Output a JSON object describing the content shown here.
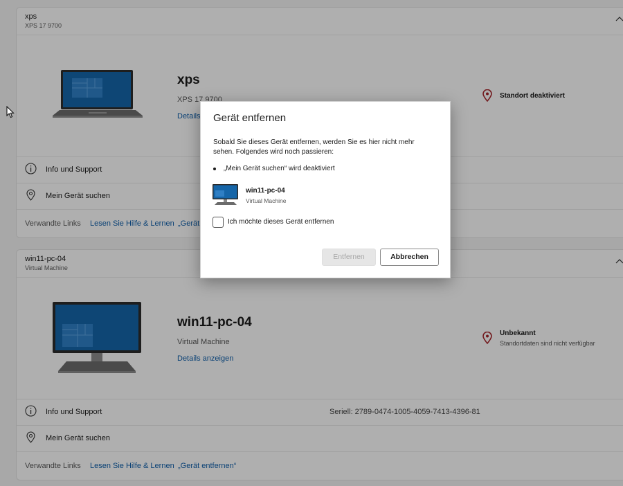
{
  "cards": [
    {
      "head_name": "xps",
      "head_sub": "XPS 17 9700",
      "big_name": "xps",
      "model": "XPS 17 9700",
      "details_label": "Details",
      "location_title": "Standort deaktiviert",
      "info_label": "Info und Support",
      "find_label": "Mein Gerät suchen",
      "related_label": "Verwandte Links",
      "help_link": "Lesen Sie Hilfe & Lernen",
      "remove_link": "„Gerät"
    },
    {
      "head_name": "win11-pc-04",
      "head_sub": "Virtual Machine",
      "big_name": "win11-pc-04",
      "model": "Virtual Machine",
      "details_label": "Details anzeigen",
      "location_title": "Unbekannt",
      "location_sub": "Standortdaten sind nicht verfügbar",
      "info_label": "Info und Support",
      "serial": "Seriell: 2789-0474-1005-4059-7413-4396-81",
      "find_label": "Mein Gerät suchen",
      "related_label": "Verwandte Links",
      "help_link": "Lesen Sie Hilfe & Lernen",
      "remove_link": "„Gerät entfernen“"
    }
  ],
  "dialog": {
    "title": "Gerät entfernen",
    "body": "Sobald Sie dieses Gerät entfernen, werden Sie es hier nicht mehr sehen. Folgendes wird noch passieren:",
    "bullet": "„Mein Gerät suchen“ wird deaktiviert",
    "device_name": "win11-pc-04",
    "device_sub": "Virtual Machine",
    "checkbox_label": "Ich möchte dieses Gerät entfernen",
    "checkbox_checked": false,
    "remove_button": "Entfernen",
    "cancel_button": "Abbrechen"
  },
  "colors": {
    "accent": "#0f5ea8",
    "location_pin": "#a4262c",
    "screen_blue": "#1565a8"
  },
  "icons": {
    "info": "info-icon",
    "find": "location-pin-icon",
    "chevron": "chevron-up-icon",
    "cursor": "mouse-cursor"
  }
}
